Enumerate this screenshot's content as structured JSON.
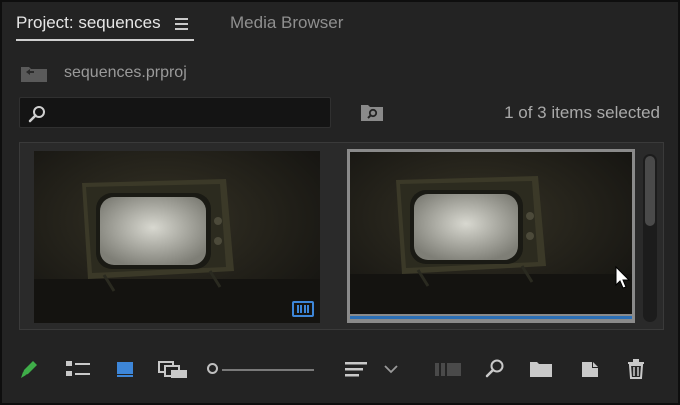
{
  "tabs": {
    "project_label": "Project: sequences",
    "media_browser_label": "Media Browser"
  },
  "project_file": {
    "name": "sequences.prproj"
  },
  "search": {
    "value": "",
    "placeholder": ""
  },
  "selection_status": "1 of 3 items selected",
  "thumbnails": [
    {
      "name": "thumbnail-1",
      "selected": false,
      "is_sequence": true
    },
    {
      "name": "thumbnail-2",
      "selected": true,
      "is_sequence": false
    }
  ],
  "colors": {
    "accent_blue": "#3d86d8",
    "pencil_green": "#3fae49",
    "panel_bg": "#232323"
  },
  "toolbar": {
    "icons": [
      "pencil-icon",
      "list-view-icon",
      "icon-view-icon",
      "freeform-view-icon",
      "zoom-slider",
      "sort-icon",
      "chevron-down-icon",
      "automate-to-sequence-icon",
      "find-icon",
      "new-bin-icon",
      "new-item-icon",
      "clear-icon"
    ]
  }
}
